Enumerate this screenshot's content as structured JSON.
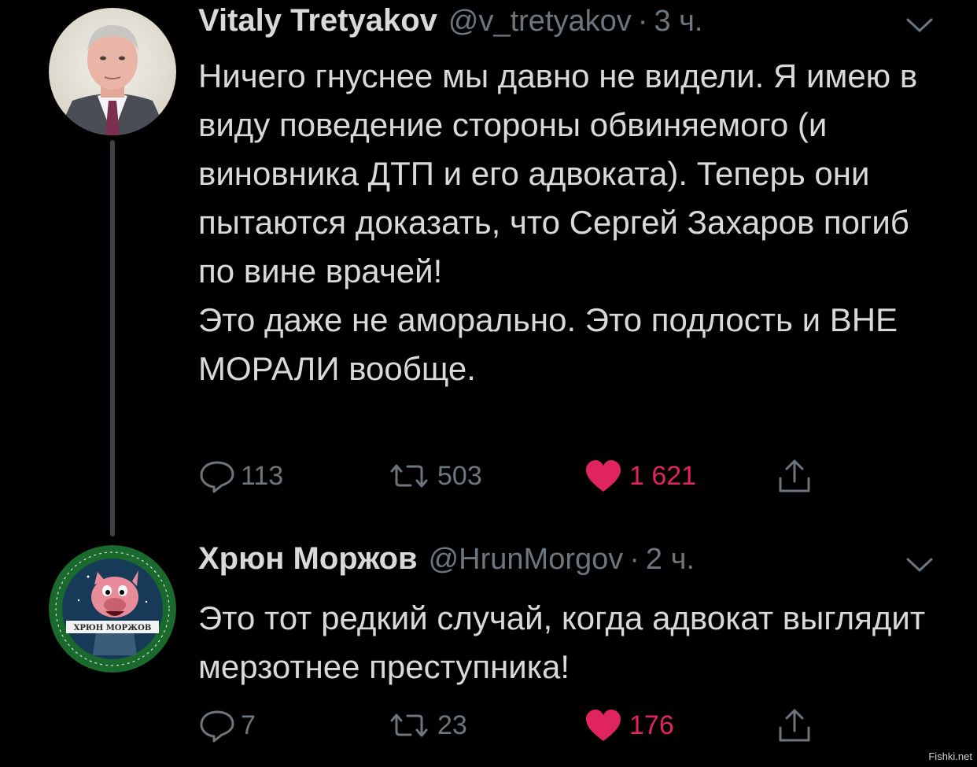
{
  "tweets": [
    {
      "display_name": "Vitaly Tretyakov",
      "handle": "@v_tretyakov",
      "separator": "·",
      "time": "3 ч.",
      "text": "Ничего гнуснее мы давно не видели. Я имею в виду поведение стороны обвиняемого (и виновника ДТП и его адвоката).  Теперь они пытаются доказать, что Сергей Захаров погиб по вине врачей!\nЭто даже не аморально. Это подлость и ВНЕ МОРАЛИ вообще.",
      "replies": "113",
      "retweets": "503",
      "likes": "1 621",
      "liked": true
    },
    {
      "display_name": "Хрюн Моржов",
      "handle": "@HrunMorgov",
      "separator": "·",
      "time": "2 ч.",
      "text": "Это тот редкий случай, когда адвокат выглядит мерзотнее преступника!",
      "replies": "7",
      "retweets": "23",
      "likes": "176",
      "liked": true
    }
  ],
  "colors": {
    "background": "#000000",
    "text": "#d9d9d9",
    "muted": "#6e767d",
    "like": "#e0245e",
    "thread_line": "#3d4145"
  },
  "icons": {
    "reply": "reply-bubble-icon",
    "retweet": "retweet-icon",
    "like": "heart-filled-icon",
    "share": "share-upload-icon",
    "menu": "chevron-down-icon"
  },
  "watermark": "Fishki.net"
}
